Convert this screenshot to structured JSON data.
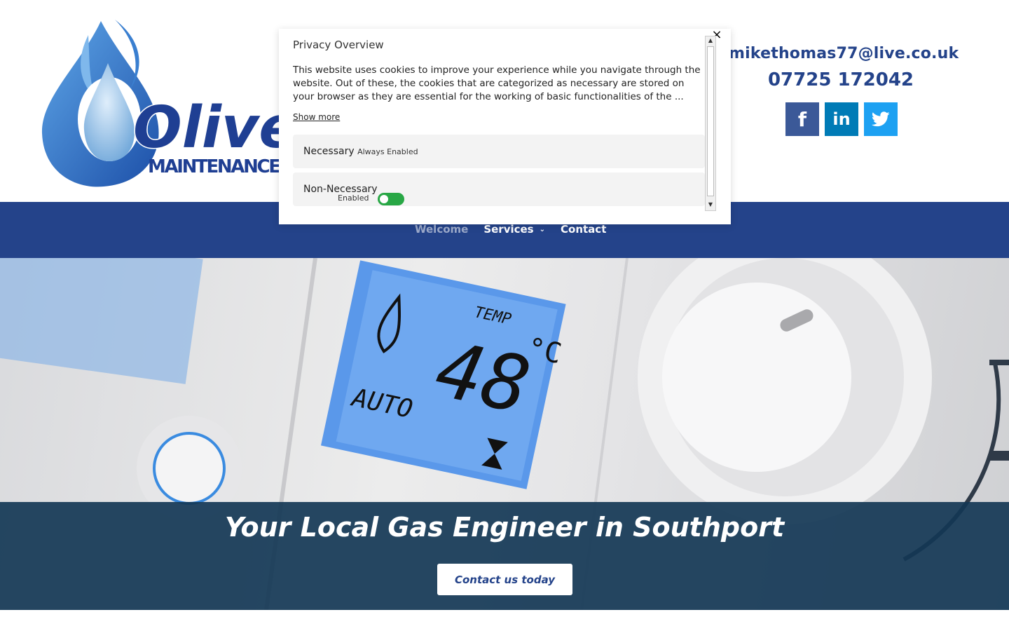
{
  "header": {
    "logo_text": "Olive",
    "logo_subtext": "MAINTENANCE",
    "email": "mikethomas77@live.co.uk",
    "phone": "07725 172042",
    "social": [
      {
        "name": "facebook",
        "glyph": "f"
      },
      {
        "name": "linkedin",
        "glyph": "in"
      },
      {
        "name": "twitter",
        "glyph": "twitter-bird"
      }
    ]
  },
  "nav": {
    "items": [
      {
        "label": "Welcome",
        "active": true
      },
      {
        "label": "Services",
        "has_dropdown": true
      },
      {
        "label": "Contact"
      }
    ]
  },
  "hero": {
    "title": "Your Local Gas Engineer in Southport",
    "cta": "Contact us today"
  },
  "cookie_modal": {
    "close_glyph": "×",
    "title": "Privacy Overview",
    "text": "This website uses cookies to improve your experience while you navigate through the website. Out of these, the cookies that are categorized as necessary are stored on your browser as they are essential for the working of basic functionalities of the ...",
    "show_more": "Show more",
    "necessary_label": "Necessary",
    "necessary_status": "Always Enabled",
    "non_necessary_label": "Non-Necessary",
    "non_necessary_status": "Enabled"
  },
  "colors": {
    "brand_blue": "#24438a",
    "facebook": "#3b5998",
    "linkedin": "#007bb6",
    "twitter": "#1da1f2",
    "toggle_on": "#28a745"
  }
}
